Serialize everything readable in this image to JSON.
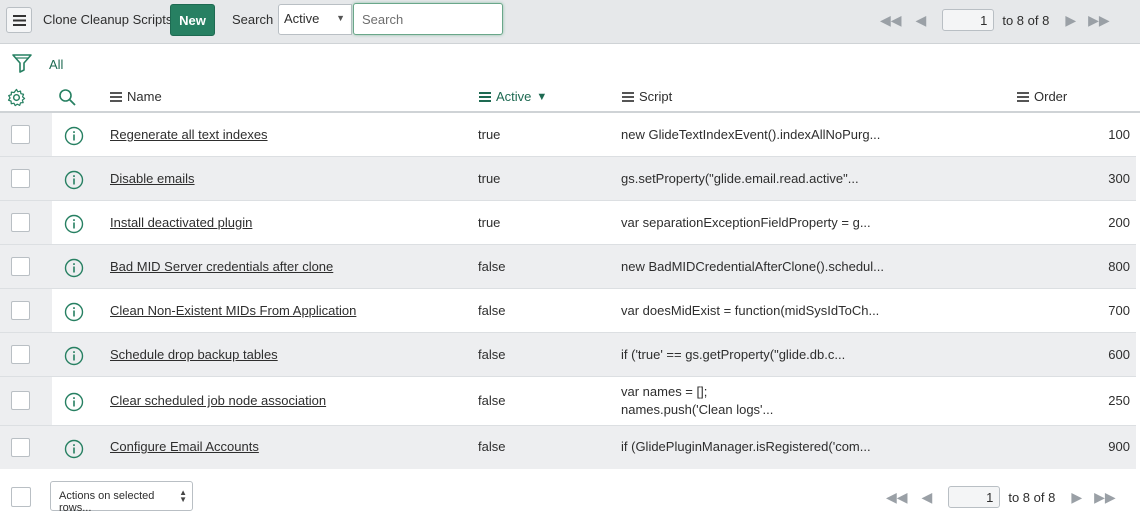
{
  "header": {
    "title": "Clone Cleanup Scripts",
    "new_label": "New",
    "search_label": "Search",
    "search_field": "Active",
    "search_placeholder": "Search",
    "page_number": "1",
    "page_range": "to 8 of 8"
  },
  "filter": {
    "breadcrumb": "All"
  },
  "columns": {
    "name": "Name",
    "active": "Active",
    "script": "Script",
    "order": "Order"
  },
  "rows": [
    {
      "name": "Regenerate all text indexes",
      "active": "true",
      "script": [
        "new GlideTextIndexEvent().indexAllNoPurg..."
      ],
      "order": "100"
    },
    {
      "name": "Disable emails",
      "active": "true",
      "script": [
        "gs.setProperty(\"glide.email.read.active\"..."
      ],
      "order": "300"
    },
    {
      "name": "Install deactivated plugin",
      "active": "true",
      "script": [
        "var separationExceptionFieldProperty = g..."
      ],
      "order": "200"
    },
    {
      "name": "Bad MID Server credentials after clone",
      "active": "false",
      "script": [
        "new BadMIDCredentialAfterClone().schedul..."
      ],
      "order": "800"
    },
    {
      "name": "Clean Non-Existent MIDs From Application",
      "active": "false",
      "script": [
        "var doesMidExist = function(midSysIdToCh..."
      ],
      "order": "700"
    },
    {
      "name": "Schedule drop backup tables",
      "active": "false",
      "script": [
        "if ('true' == gs.getProperty(\"glide.db.c..."
      ],
      "order": "600"
    },
    {
      "name": "Clear scheduled job node association",
      "active": "false",
      "script": [
        "var names = [];",
        "names.push('Clean logs'..."
      ],
      "order": "250"
    },
    {
      "name": "Configure Email Accounts",
      "active": "false",
      "script": [
        "if (GlidePluginManager.isRegistered('com..."
      ],
      "order": "900"
    }
  ],
  "footer": {
    "actions_label": "Actions on selected rows...",
    "page_number": "1",
    "page_range": "to 8 of 8"
  },
  "colors": {
    "accent": "#278062",
    "header_bg": "#e6e8ea",
    "row_alt": "#edeef0"
  }
}
